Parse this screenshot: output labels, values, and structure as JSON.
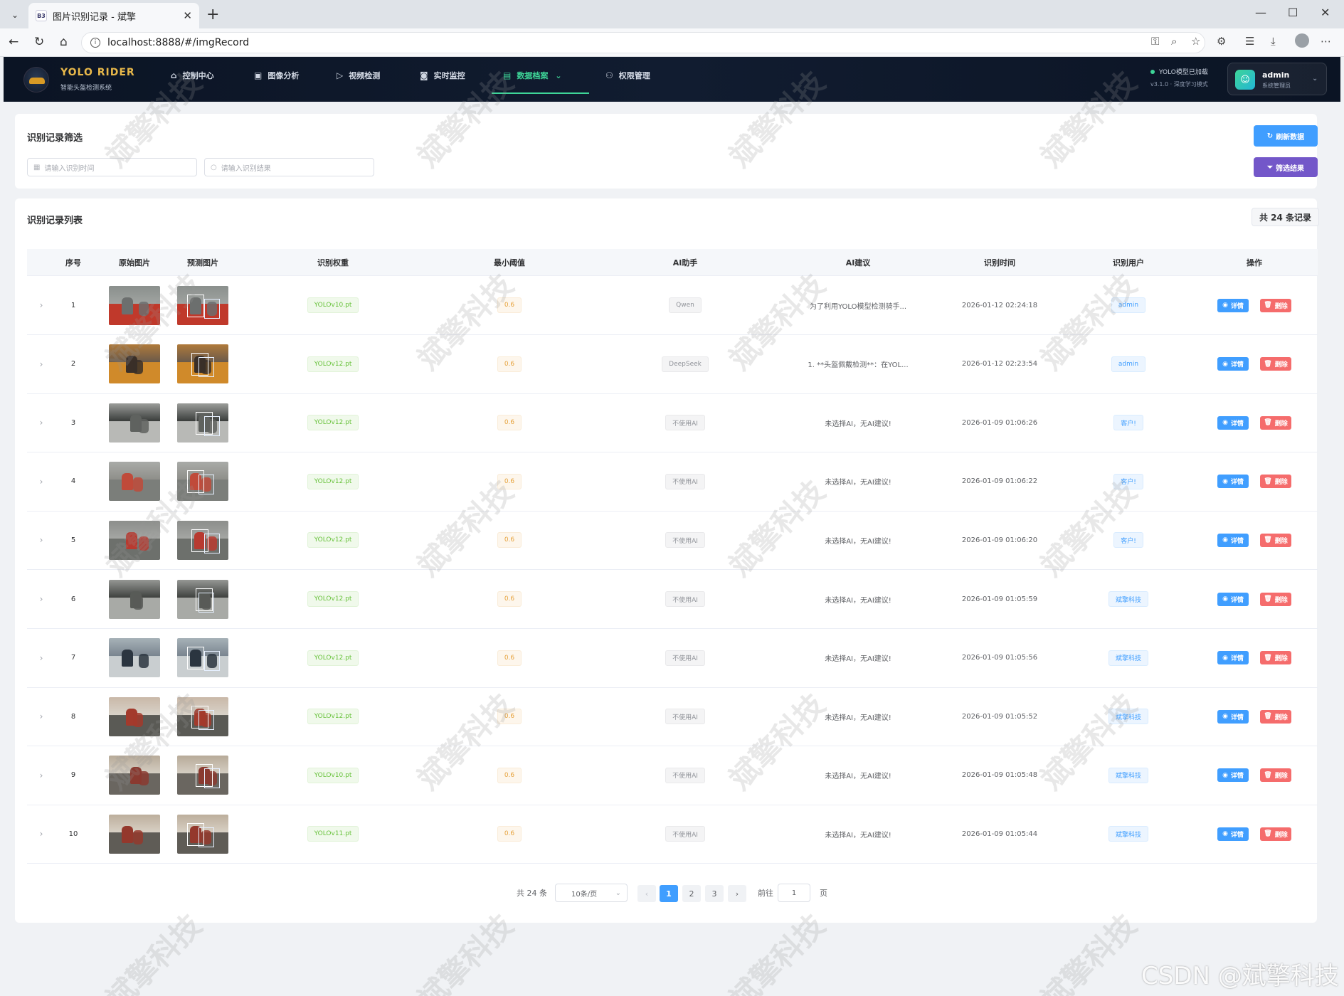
{
  "browser": {
    "tab_title": "图片识别记录 - 斌擎",
    "tab_favicon": "B3",
    "url": "localhost:8888/#/imgRecord"
  },
  "header": {
    "brand_title": "YOLO RIDER",
    "brand_subtitle": "智能头盔检测系统",
    "nav": [
      {
        "label": "控制中心",
        "icon": "home-icon"
      },
      {
        "label": "图像分析",
        "icon": "image-icon"
      },
      {
        "label": "视频检测",
        "icon": "play-icon"
      },
      {
        "label": "实时监控",
        "icon": "camera-icon"
      },
      {
        "label": "数据档案",
        "icon": "document-icon",
        "active": true
      },
      {
        "label": "权限管理",
        "icon": "user-icon"
      }
    ],
    "model_status": "YOLO模型已加载",
    "model_version": "v3.1.0 · 深度学习模式",
    "user_name": "admin",
    "user_role": "系统管理员"
  },
  "filter": {
    "title": "识别记录筛选",
    "time_placeholder": "请输入识别时间",
    "result_placeholder": "请输入识别结果",
    "refresh_label": "刷新数据",
    "filter_label": "筛选结果"
  },
  "table": {
    "title": "识别记录列表",
    "total_label": "共 24 条记录",
    "columns": [
      "序号",
      "原始图片",
      "预测图片",
      "识别权重",
      "最小阈值",
      "AI助手",
      "AI建议",
      "识别时间",
      "识别用户",
      "操作"
    ],
    "detail_label": "详情",
    "delete_label": "删除",
    "rows": [
      {
        "index": "1",
        "weight": "YOLOv10.pt",
        "threshold": "0.6",
        "ai": "Qwen",
        "advice": "为了利用YOLO模型检测骑手...",
        "time": "2026-01-12 02:24:18",
        "user": "admin"
      },
      {
        "index": "2",
        "weight": "YOLOv12.pt",
        "threshold": "0.6",
        "ai": "DeepSeek",
        "advice": "1. **头盔佩戴检测**：在YOL...",
        "time": "2026-01-12 02:23:54",
        "user": "admin"
      },
      {
        "index": "3",
        "weight": "YOLOv12.pt",
        "threshold": "0.6",
        "ai": "不使用AI",
        "advice": "未选择AI，无AI建议!",
        "time": "2026-01-09 01:06:26",
        "user": "客户!"
      },
      {
        "index": "4",
        "weight": "YOLOv12.pt",
        "threshold": "0.6",
        "ai": "不使用AI",
        "advice": "未选择AI，无AI建议!",
        "time": "2026-01-09 01:06:22",
        "user": "客户!"
      },
      {
        "index": "5",
        "weight": "YOLOv12.pt",
        "threshold": "0.6",
        "ai": "不使用AI",
        "advice": "未选择AI，无AI建议!",
        "time": "2026-01-09 01:06:20",
        "user": "客户!"
      },
      {
        "index": "6",
        "weight": "YOLOv12.pt",
        "threshold": "0.6",
        "ai": "不使用AI",
        "advice": "未选择AI，无AI建议!",
        "time": "2026-01-09 01:05:59",
        "user": "斌擎科技"
      },
      {
        "index": "7",
        "weight": "YOLOv12.pt",
        "threshold": "0.6",
        "ai": "不使用AI",
        "advice": "未选择AI，无AI建议!",
        "time": "2026-01-09 01:05:56",
        "user": "斌擎科技"
      },
      {
        "index": "8",
        "weight": "YOLOv12.pt",
        "threshold": "0.6",
        "ai": "不使用AI",
        "advice": "未选择AI，无AI建议!",
        "time": "2026-01-09 01:05:52",
        "user": "斌擎科技"
      },
      {
        "index": "9",
        "weight": "YOLOv10.pt",
        "threshold": "0.6",
        "ai": "不使用AI",
        "advice": "未选择AI，无AI建议!",
        "time": "2026-01-09 01:05:48",
        "user": "斌擎科技"
      },
      {
        "index": "10",
        "weight": "YOLOv11.pt",
        "threshold": "0.6",
        "ai": "不使用AI",
        "advice": "未选择AI，无AI建议!",
        "time": "2026-01-09 01:05:44",
        "user": "斌擎科技"
      }
    ]
  },
  "pagination": {
    "total": "共 24 条",
    "page_size": "10条/页",
    "pages": [
      "1",
      "2",
      "3"
    ],
    "current": "1",
    "goto_label": "前往",
    "goto_value": "1",
    "page_suffix": "页"
  },
  "watermark": "斌擎科技",
  "footer_mark": "CSDN @斌擎科技"
}
